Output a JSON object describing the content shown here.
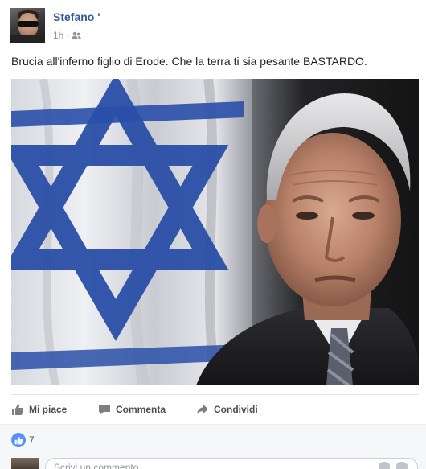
{
  "post": {
    "author_name": "Stefano '",
    "timestamp": "1h",
    "separator": "·",
    "audience_icon": "friends-icon",
    "text": "Brucia all'inferno figlio di Erode. Che la terra ti sia pesante BASTARDO."
  },
  "actions": {
    "like_label": "Mi piace",
    "comment_label": "Commenta",
    "share_label": "Condividi"
  },
  "reactions": {
    "like_count": "7"
  },
  "comment": {
    "placeholder": "Scrivi un commento..."
  },
  "colors": {
    "link_blue": "#365899",
    "like_blue": "#5890ff",
    "action_gray": "#4b4f56",
    "flag_blue": "#2a4fa8"
  }
}
